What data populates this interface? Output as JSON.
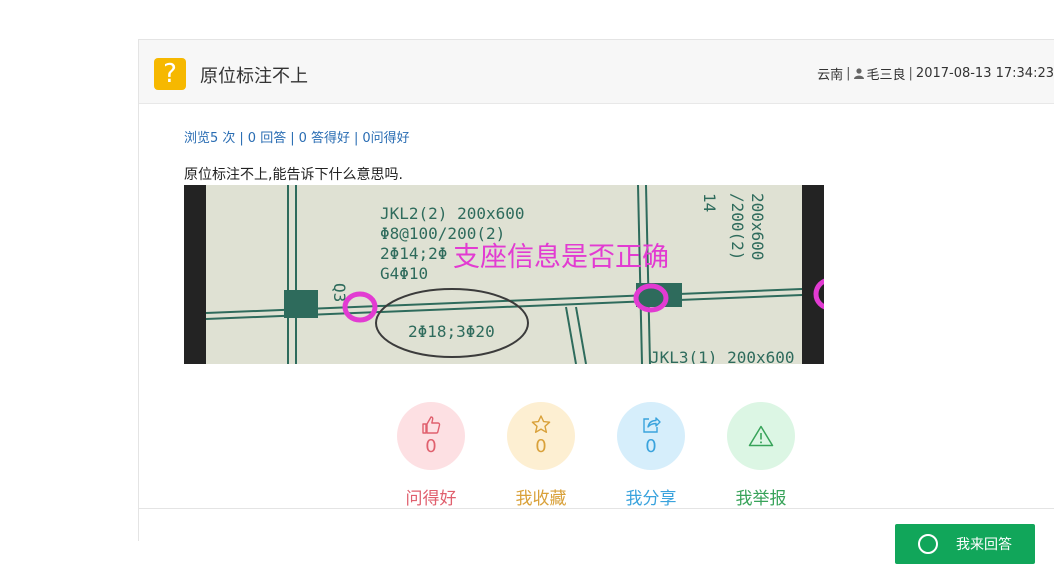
{
  "question": {
    "icon": "question-icon",
    "title": "原位标注不上",
    "meta": {
      "region": "云南",
      "user": "毛三良",
      "datetime": "2017-08-13 17:34:23"
    },
    "stats": {
      "views": "浏览5 次",
      "answers": "0 回答",
      "good_answers": "0 答得好",
      "good_questions": "0问得好"
    },
    "body_text": "原位标注不上,能告诉下什么意思吗.",
    "image": {
      "annotation_text": "支座信息是否正确",
      "drawing_labels": {
        "beam1": "JKL2(2) 200x600",
        "beam1_stirrup": "Φ8@100/200(2)",
        "beam1_top": "2Φ14;2Φ",
        "beam1_side": "G4Φ10",
        "col": "Q3",
        "circled_note": "2Φ18;3Φ20",
        "beam2": "JKL3(1) 200x600",
        "right_top": "200x600",
        "right_mid": "/200(2)",
        "right_small": "14"
      },
      "colors": {
        "annotation": "#e23bd2",
        "drawing": "#2e6b5c"
      }
    }
  },
  "actions": [
    {
      "icon": "thumbs-up-icon",
      "count": "0",
      "label": "问得好",
      "bg": "#fde0e3",
      "fg": "#e0606e"
    },
    {
      "icon": "star-icon",
      "count": "0",
      "label": "我收藏",
      "bg": "#fdefd2",
      "fg": "#d9a13a"
    },
    {
      "icon": "share-icon",
      "count": "0",
      "label": "我分享",
      "bg": "#d6eefb",
      "fg": "#3aa3dd"
    },
    {
      "icon": "warning-icon",
      "count": "",
      "label": "我举报",
      "bg": "#dcf6e4",
      "fg": "#38a35a"
    }
  ],
  "footer": {
    "answer_button": "我来回答"
  }
}
